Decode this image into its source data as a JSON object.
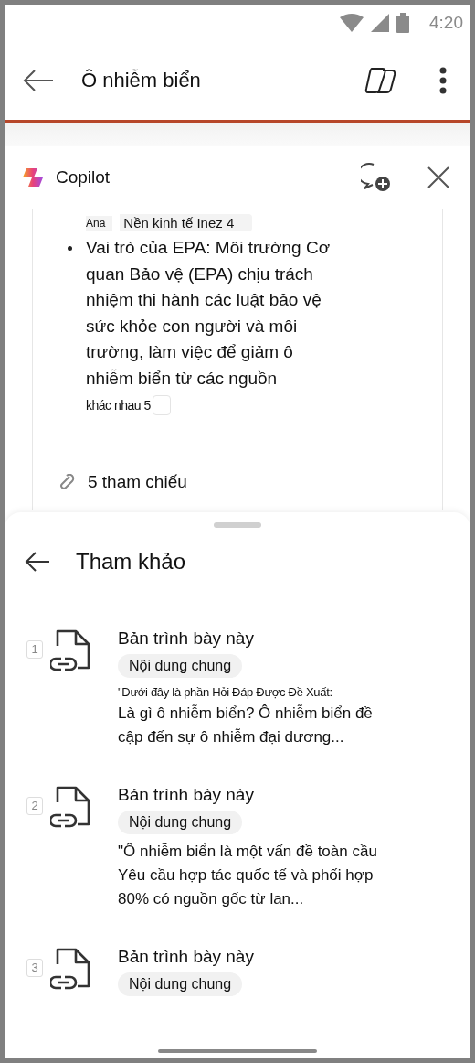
{
  "status_bar": {
    "time": "4:20"
  },
  "app_bar": {
    "title": "Ô nhiễm biển"
  },
  "copilot": {
    "title": "Copilot",
    "chat": {
      "author": "Ana",
      "citation_tail": "Nền kinh tế Inez 4",
      "bullet": "Vai trò của EPA: Môi trường Cơ quan Bảo vệ (EPA) chịu trách nhiệm thi hành các luật bảo vệ sức khỏe con người và môi trường, làm việc để giảm ô nhiễm biển từ các nguồn",
      "bullet_tail": "khác nhau 5",
      "references_link": "5 tham chiếu"
    }
  },
  "references_sheet": {
    "title": "Tham khảo",
    "items": [
      {
        "number": "1",
        "title": "Bản trình bày này",
        "tag": "Nội dung chung",
        "quote_intro": "\"Dưới đây là phần Hỏi Đáp Được Đề Xuất:",
        "quote": "Là gì ô nhiễm biển? Ô nhiễm biển đề cập đến sự ô nhiễm đại dương..."
      },
      {
        "number": "2",
        "title": "Bản trình bày này",
        "tag": "Nội dung chung",
        "quote": "\"Ô nhiễm biển là một vấn đề toàn cầu Yêu cầu hợp tác quốc tế và phối hợp 80% có nguồn gốc từ lan..."
      },
      {
        "number": "3",
        "title": "Bản trình bày này",
        "tag": "Nội dung chung"
      }
    ]
  }
}
